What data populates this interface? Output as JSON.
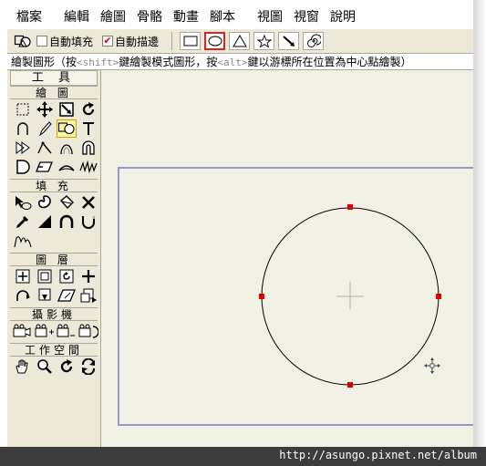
{
  "menubar": {
    "items": [
      "檔案",
      "編輯",
      "繪圖",
      "骨骼",
      "動畫",
      "腳本",
      "視圖",
      "視窗",
      "說明"
    ]
  },
  "optionbar": {
    "fill_label": "自動填充",
    "fill_checked": false,
    "stroke_label": "自動描邊",
    "stroke_checked": true,
    "shapes": [
      "rectangle",
      "ellipse",
      "triangle",
      "star",
      "arrow",
      "spiral"
    ],
    "active_shape": "ellipse"
  },
  "statusbar": {
    "prefix": "繪製圖形（按",
    "key1": "<shift>",
    "middle": "鍵繪製模式圖形，按",
    "key2": "<alt>",
    "suffix": "鍵以游標所在位置為中心點繪製）"
  },
  "toolbox": {
    "title": "工 具",
    "sections": [
      {
        "label": "繪 圖",
        "tools": [
          "select-points-icon",
          "transform-icon",
          "scale-icon",
          "rotate-icon",
          "curve-icon",
          "pen-icon",
          "draw-shapes-icon",
          "text-icon",
          "insert-point-icon",
          "peak-icon",
          "curvature-icon",
          "magnet-icon",
          "close-shape-icon",
          "shear-icon",
          "bend-icon",
          "noise-icon"
        ],
        "active": "draw-shapes-icon"
      },
      {
        "label": "填 充",
        "tools": [
          "select-shape-icon",
          "fill-icon",
          "paint-bucket-icon",
          "delete-icon",
          "eyedropper-icon",
          "line-width-icon",
          "stroke-icon",
          "hide-edge-icon",
          "exposure-icon"
        ]
      },
      {
        "label": "圖 層",
        "tools": [
          "translate-layer-icon",
          "scale-layer-icon",
          "rotate-layer-icon",
          "set-origin-icon",
          "follow-path-icon",
          "rotate-3d-icon",
          "shear-layer-icon",
          "flip-icon"
        ]
      },
      {
        "label": "攝影機",
        "tools": [
          "track-camera-icon",
          "zoom-camera-icon",
          "roll-camera-icon",
          "pan-camera-icon"
        ]
      },
      {
        "label": "工作空間",
        "tools": [
          "hand-icon",
          "magnify-icon",
          "orbit-icon",
          "reset-view-icon"
        ]
      }
    ]
  },
  "footer": {
    "url": "http://asungo.pixnet.net/album"
  },
  "colors": {
    "toolbar_bg": "#ece9d8",
    "canvas_bg": "#f1f0e4",
    "stage_border": "#9b96c8",
    "handle": "#e00000",
    "active_tool": "#fff6a0"
  }
}
